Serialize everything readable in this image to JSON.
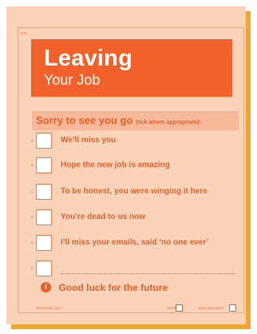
{
  "form": {
    "ref": "MS1",
    "title": "Leaving",
    "subtitle": "Your Job",
    "prompt": "Sorry to see you go",
    "prompt_hint": "(tick where appropriate):",
    "options": [
      {
        "letter": "A",
        "label": "We’ll miss you",
        "checked": false
      },
      {
        "letter": "B",
        "label": "Hope the new job is amazing",
        "checked": false
      },
      {
        "letter": "C",
        "label": "To be honest, you were winging it here",
        "checked": false
      },
      {
        "letter": "D",
        "label": "You’re dead to us now",
        "checked": false
      },
      {
        "letter": "E",
        "label": "I’ll miss your emails, said ‘no one ever’",
        "checked": false
      },
      {
        "letter": "F",
        "label": "",
        "checked": false
      }
    ],
    "closing": "Good luck for the future",
    "closing_icon": "info-icon",
    "footer": {
      "office_use": "OFFICE USE ONLY",
      "posted": "POSTED",
      "hand_delivered": "HAND DELIVERED"
    }
  },
  "colors": {
    "card_bg": "#fbd3b9",
    "accent": "#f2612b",
    "text": "#e85f29",
    "shadow": "#f3a532"
  }
}
